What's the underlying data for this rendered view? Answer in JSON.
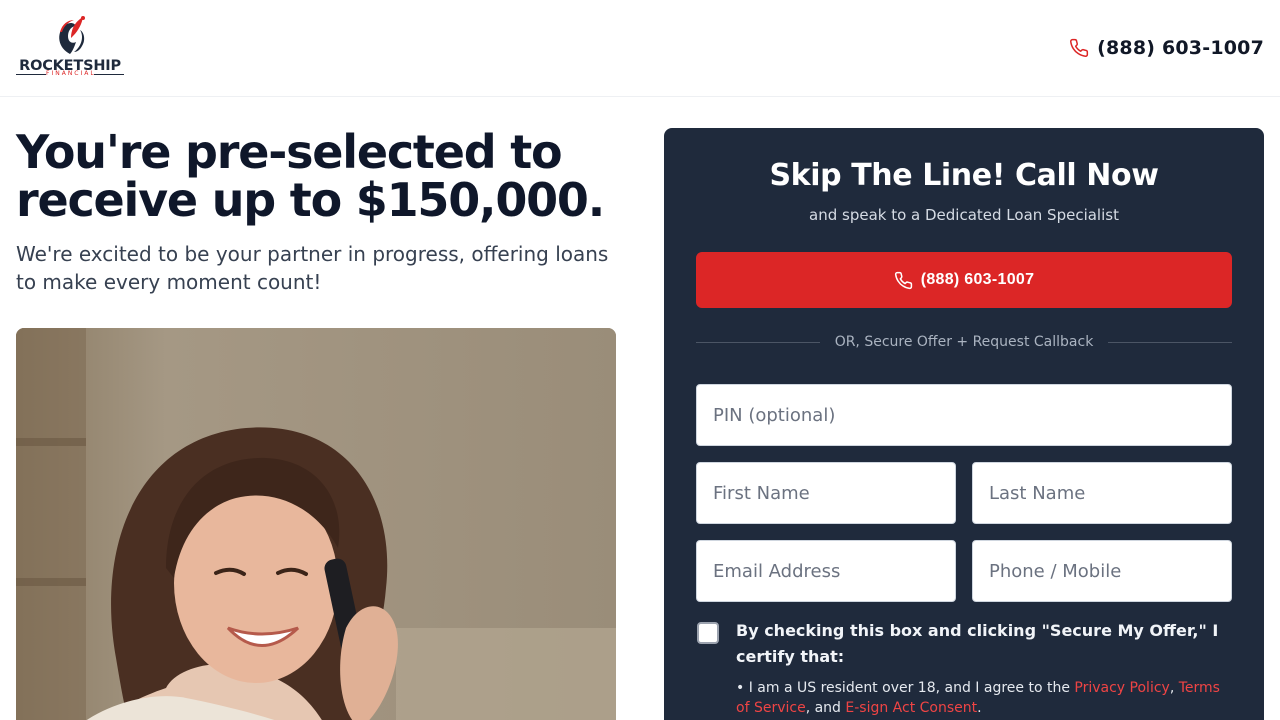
{
  "brand": {
    "name": "ROCKETSHIP",
    "subtitle": "FINANCIAL",
    "accent": "#dc2626",
    "navy": "#1f2a3c"
  },
  "header": {
    "phone": "(888) 603-1007",
    "phone_icon": "phone-icon"
  },
  "hero": {
    "title": "You're pre-selected to receive up to $150,000.",
    "subtitle": "We're excited to be your partner in progress, offering loans to make every moment count!"
  },
  "card": {
    "title": "Skip The Line! Call Now",
    "subtitle": "and speak to a Dedicated Loan Specialist",
    "call_button": "(888) 603-1007",
    "divider": "OR, Secure Offer + Request Callback",
    "fields": {
      "pin": "PIN (optional)",
      "first_name": "First Name",
      "last_name": "Last Name",
      "email": "Email Address",
      "phone": "Phone / Mobile"
    },
    "consent": {
      "title": "By checking this box and clicking \"Secure My Offer,\" I certify that:",
      "body_prefix": "• I am a US resident over 18, and I agree to the ",
      "privacy_link": "Privacy Policy",
      "sep1": ", ",
      "terms_link": "Terms of Service",
      "sep2": ", and ",
      "esign_link": "E-sign Act Consent",
      "body_suffix": "."
    }
  }
}
